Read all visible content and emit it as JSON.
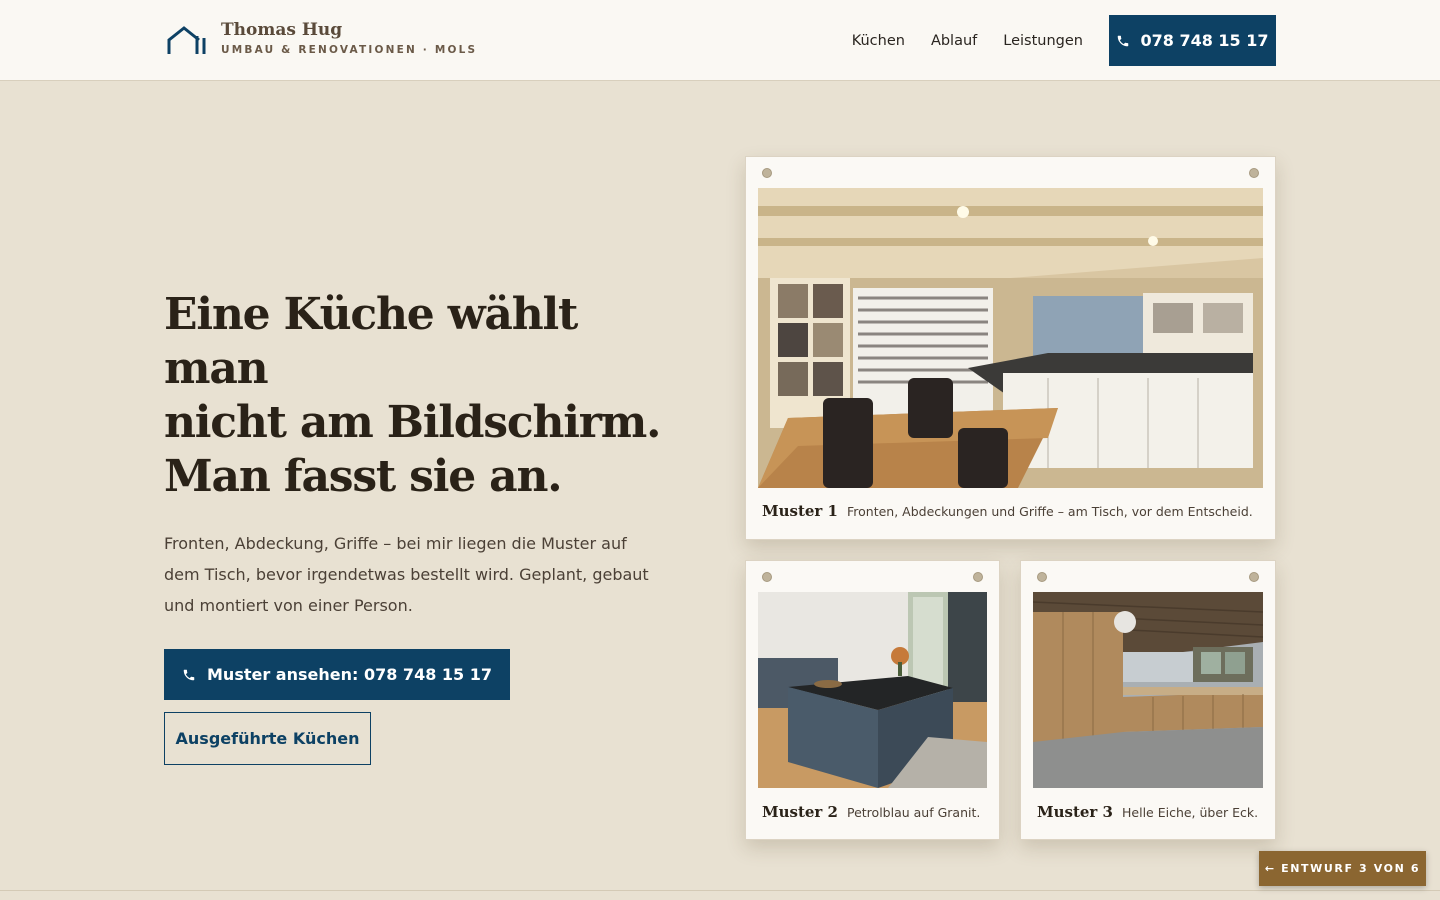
{
  "brand": {
    "name": "Thomas Hug",
    "subtitle": "UMBAU & RENOVATIONEN · MOLS",
    "logo_icon": "house-outline-icon",
    "accent": "#0d4164"
  },
  "nav": {
    "links": [
      "Küchen",
      "Ablauf",
      "Leistungen"
    ],
    "phone_label": "078 748 15 17",
    "phone_icon": "phone-icon"
  },
  "hero": {
    "headline_line1": "Eine Küche wählt man",
    "headline_line2": "nicht am Bildschirm.",
    "headline_line3": "Man fasst sie an.",
    "lead": "Fronten, Abdeckung, Griffe – bei mir liegen die Muster auf dem Tisch, bevor irgendetwas bestellt wird. Geplant, gebaut und montiert von einer Person.",
    "cta_primary": "Muster ansehen: 078 748 15 17",
    "cta_secondary": "Ausgeführte Küchen"
  },
  "samples": [
    {
      "title": "Muster 1",
      "caption": "Fronten, Abdeckungen und Griffe – am Tisch, vor dem Entscheid."
    },
    {
      "title": "Muster 2",
      "caption": "Petrolblau auf Granit."
    },
    {
      "title": "Muster 3",
      "caption": "Helle Eiche, über Eck."
    }
  ],
  "draft_badge": "← ENTWURF 3 VON 6",
  "colors": {
    "background": "#e8e1d2",
    "header": "#faf8f3",
    "primary": "#0d4164",
    "badge": "#8b6631"
  }
}
